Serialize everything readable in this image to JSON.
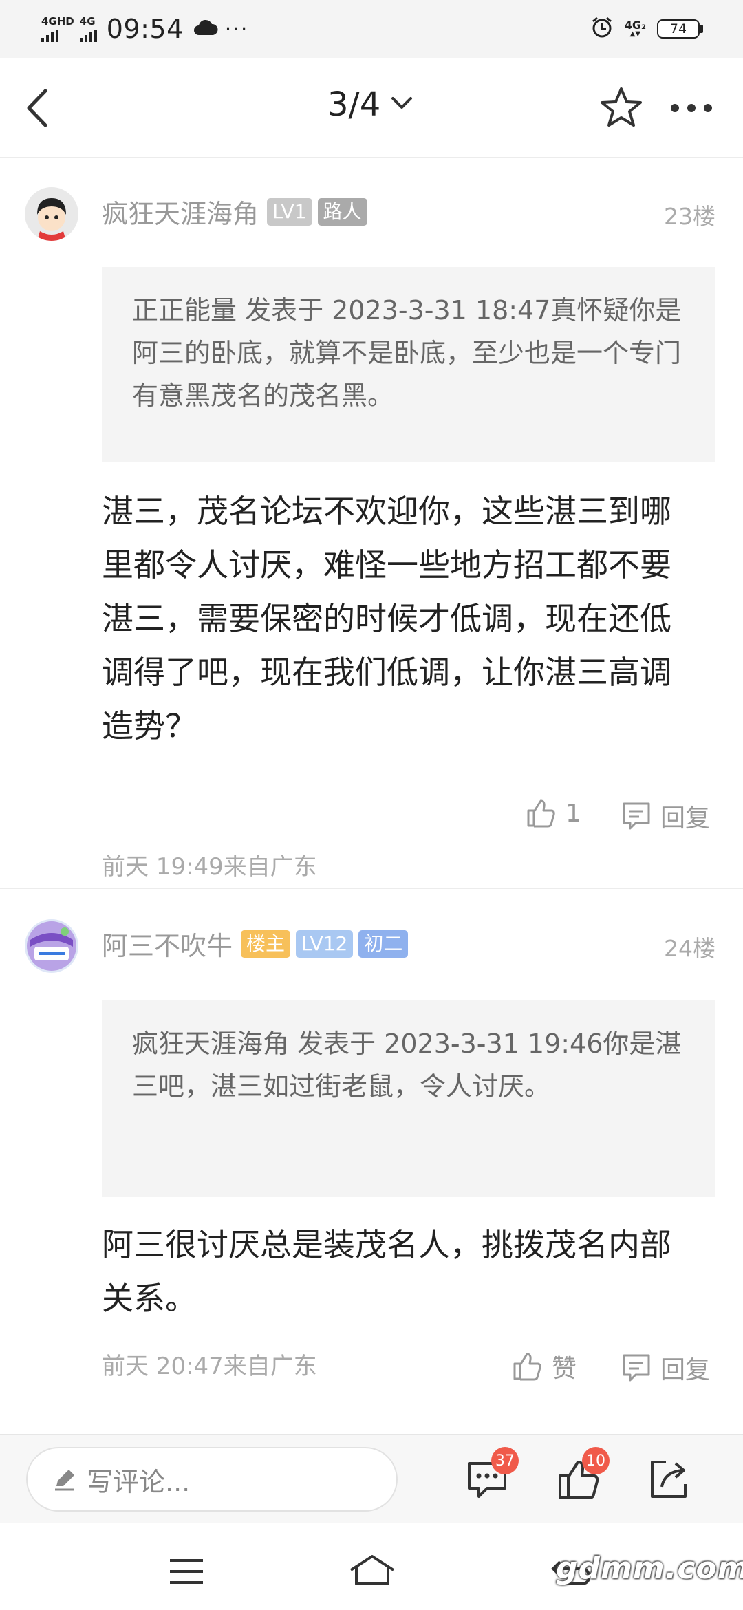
{
  "status_bar": {
    "net1": "4GHD",
    "net2": "4G",
    "time": "09:54",
    "more": "···",
    "net_right": "4G₂",
    "battery": "74"
  },
  "nav": {
    "page": "3/4"
  },
  "posts": [
    {
      "username": "疯狂天涯海角",
      "badges": [
        {
          "text": "LV1",
          "color": "#c8c8c8"
        },
        {
          "text": "路人",
          "color": "#aaaaaa"
        }
      ],
      "floor": "23楼",
      "quote": "正正能量 发表于 2023-3-31 18:47真怀疑你是阿三的卧底，就算不是卧底，至少也是一个专门有意黑茂名的茂名黑。",
      "content": "湛三，茂名论坛不欢迎你，这些湛三到哪里都令人讨厌，难怪一些地方招工都不要湛三，需要保密的时候才低调，现在还低调得了吧，现在我们低调，让你湛三高调造势？",
      "time": "前天 19:49来自广东",
      "like_label": "1",
      "reply_label": "回复"
    },
    {
      "username": "阿三不吹牛",
      "badges": [
        {
          "text": "楼主",
          "color": "#f7c05a"
        },
        {
          "text": "LV12",
          "color": "#a9c8f2"
        },
        {
          "text": "初二",
          "color": "#8fb1ee"
        }
      ],
      "floor": "24楼",
      "quote": "疯狂天涯海角 发表于 2023-3-31 19:46你是湛三吧，湛三如过街老鼠，令人讨厌。",
      "content": "阿三很讨厌总是装茂名人，挑拨茂名内部关系。",
      "time": "前天 20:47来自广东",
      "like_label": "赞",
      "reply_label": "回复"
    }
  ],
  "comment_bar": {
    "placeholder": "写评论...",
    "comment_count": "37",
    "like_count": "10"
  },
  "watermark": "gdmm.com",
  "icons": {
    "back": "chevron-left-icon",
    "dropdown": "chevron-down-icon",
    "favorite": "star-icon",
    "more": "more-dots-icon",
    "like": "thumbs-up-icon",
    "reply": "comment-bubble-icon",
    "edit": "pencil-icon",
    "comments": "comments-icon",
    "share": "share-icon"
  }
}
